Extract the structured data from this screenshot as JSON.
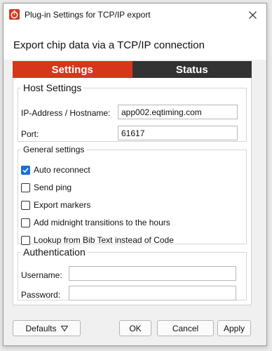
{
  "window": {
    "title": "Plug-in Settings for TCP/IP export"
  },
  "header": {
    "text": "Export chip data via a TCP/IP connection"
  },
  "tabs": [
    {
      "label": "Settings",
      "active": true
    },
    {
      "label": "Status",
      "active": false
    }
  ],
  "host_settings": {
    "title": "Host Settings",
    "ip_label": "IP-Address / Hostname:",
    "ip_value": "app002.eqtiming.com",
    "port_label": "Port:",
    "port_value": "61617"
  },
  "general_settings": {
    "title": "General settings",
    "options": [
      {
        "label": "Auto reconnect",
        "checked": true
      },
      {
        "label": "Send ping",
        "checked": false
      },
      {
        "label": "Export markers",
        "checked": false
      },
      {
        "label": "Add midnight transitions to the hours",
        "checked": false
      },
      {
        "label": "Lookup from Bib Text instead of Code",
        "checked": false
      }
    ]
  },
  "authentication": {
    "title": "Authentication",
    "username_label": "Username:",
    "username_value": "",
    "password_label": "Password:",
    "password_value": ""
  },
  "footer": {
    "defaults_label": "Defaults",
    "ok_label": "OK",
    "cancel_label": "Cancel",
    "apply_label": "Apply"
  },
  "colors": {
    "accent": "#d6371a",
    "tab_inactive": "#333333",
    "checkbox": "#1d6fd6"
  }
}
